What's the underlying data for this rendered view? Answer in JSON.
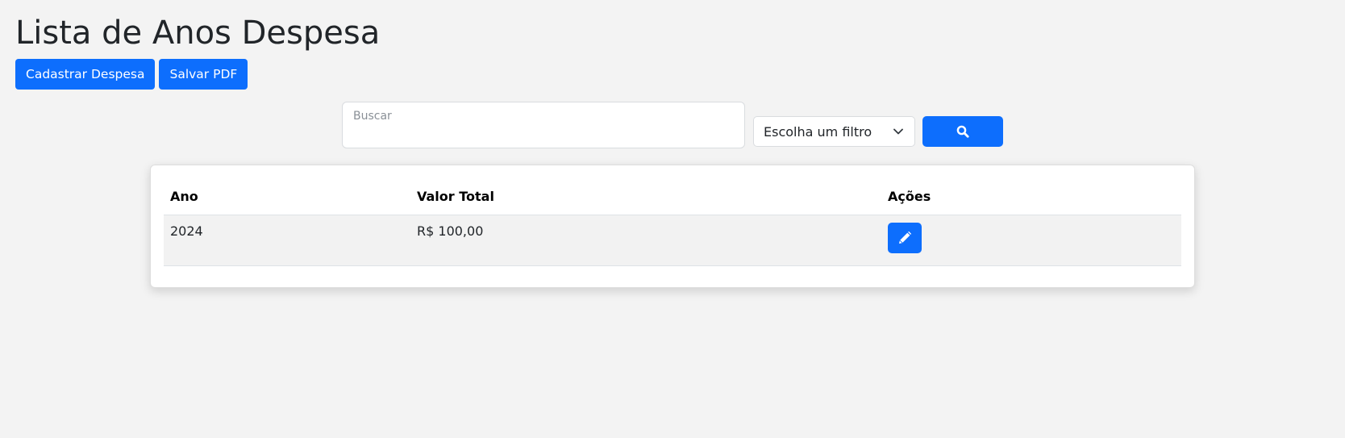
{
  "page": {
    "title": "Lista de Anos Despesa"
  },
  "actions": {
    "register_label": "Cadastrar Despesa",
    "pdf_label": "Salvar PDF"
  },
  "search": {
    "label": "Buscar",
    "value": "",
    "filter_selected": "Escolha um filtro",
    "button_icon": "search-icon"
  },
  "table": {
    "headers": [
      "Ano",
      "Valor Total",
      "Ações"
    ],
    "rows": [
      {
        "ano": "2024",
        "valor_total": "R$ 100,00",
        "action_icon": "pencil-icon"
      }
    ]
  },
  "colors": {
    "primary": "#0d6efd",
    "background": "#f3f3f3",
    "row_background": "#f2f2f2"
  }
}
